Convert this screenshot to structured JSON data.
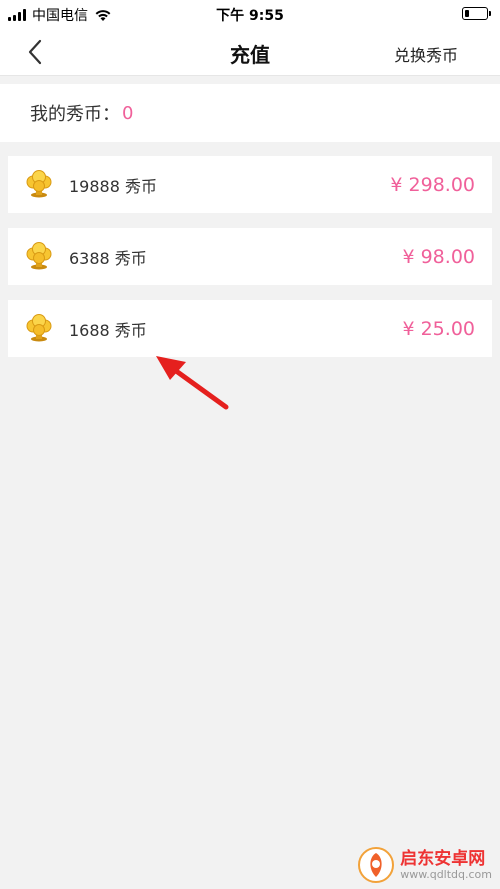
{
  "status_bar": {
    "carrier": "中国电信",
    "time": "下午 9:55",
    "battery_level": 0.2
  },
  "nav": {
    "title": "充值",
    "action_label": "兑换秀币",
    "back_icon": "chevron-left-icon"
  },
  "balance": {
    "label": "我的秀币：",
    "value": "0"
  },
  "packages": [
    {
      "name": "19888 秀币",
      "price": "¥ 298.00",
      "icon": "coin-stack-icon"
    },
    {
      "name": "6388 秀币",
      "price": "¥ 98.00",
      "icon": "coin-stack-icon"
    },
    {
      "name": "1688 秀币",
      "price": "¥ 25.00",
      "icon": "coin-stack-icon"
    }
  ],
  "annotation": {
    "icon": "red-arrow-icon",
    "color": "#e5201e"
  },
  "watermark": {
    "title": "启东安卓网",
    "url": "www.qdltdq.com"
  },
  "colors": {
    "accent": "#f0609a",
    "background": "#f2f2f2",
    "card": "#ffffff"
  }
}
